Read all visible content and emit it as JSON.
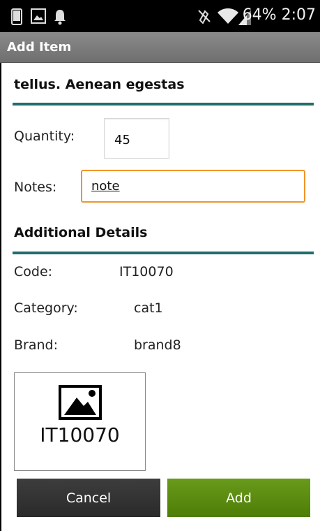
{
  "status_bar": {
    "battery": "64%",
    "time": "2:07"
  },
  "header": {
    "title": "Add Item"
  },
  "item": {
    "name": "tellus. Aenean egestas"
  },
  "form": {
    "quantity_label": "Quantity:",
    "quantity_value": "45",
    "notes_label": "Notes:",
    "notes_value": "note"
  },
  "details": {
    "section_title": "Additional Details",
    "code_label": "Code:",
    "code_value": "IT10070",
    "category_label": "Category:",
    "category_value": "cat1",
    "brand_label": "Brand:",
    "brand_value": "brand8"
  },
  "thumbnail": {
    "label": "IT10070",
    "icon": "image-icon"
  },
  "actions": {
    "cancel_label": "Cancel",
    "add_label": "Add"
  },
  "colors": {
    "accent_divider": "#1f6e6c",
    "focus_border": "#f0952a",
    "add_button": "#5a8a10",
    "cancel_button": "#333333"
  },
  "icons": [
    "phone-icon",
    "gallery-icon",
    "bell-icon",
    "mute-icon",
    "wifi-icon",
    "signal-icon"
  ]
}
